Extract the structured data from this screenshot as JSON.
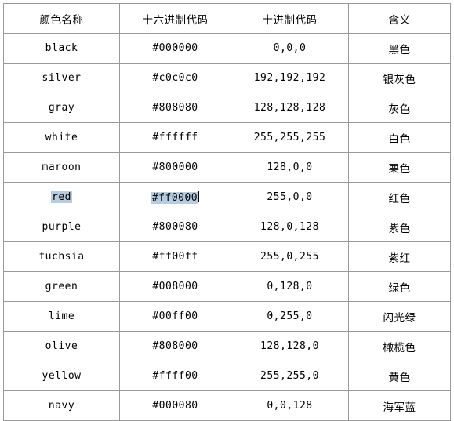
{
  "table": {
    "headers": [
      "颜色名称",
      "十六进制代码",
      "十进制代码",
      "含义"
    ],
    "rows": [
      {
        "name": "black",
        "hex": "#000000",
        "dec": "0,0,0",
        "meaning": "黑色"
      },
      {
        "name": "silver",
        "hex": "#c0c0c0",
        "dec": "192,192,192",
        "meaning": "银灰色"
      },
      {
        "name": "gray",
        "hex": "#808080",
        "dec": "128,128,128",
        "meaning": "灰色"
      },
      {
        "name": "white",
        "hex": "#ffffff",
        "dec": "255,255,255",
        "meaning": "白色"
      },
      {
        "name": "maroon",
        "hex": "#800000",
        "dec": "128,0,0",
        "meaning": "栗色"
      },
      {
        "name": "red",
        "hex": "#ff0000",
        "dec": "255,0,0",
        "meaning": "红色"
      },
      {
        "name": "purple",
        "hex": "#800080",
        "dec": "128,0,128",
        "meaning": "紫色"
      },
      {
        "name": "fuchsia",
        "hex": "#ff00ff",
        "dec": "255,0,255",
        "meaning": "紫红"
      },
      {
        "name": "green",
        "hex": "#008000",
        "dec": "0,128,0",
        "meaning": "绿色"
      },
      {
        "name": "lime",
        "hex": "#00ff00",
        "dec": "0,255,0",
        "meaning": "闪光绿"
      },
      {
        "name": "olive",
        "hex": "#808000",
        "dec": "128,128,0",
        "meaning": "橄榄色"
      },
      {
        "name": "yellow",
        "hex": "#ffff00",
        "dec": "255,255,0",
        "meaning": "黄色"
      },
      {
        "name": "navy",
        "hex": "#000080",
        "dec": "0,0,128",
        "meaning": "海军蓝"
      }
    ],
    "selection": {
      "row_index": 5,
      "selected_name": "red",
      "selected_hex": "#ff0000",
      "highlight_color": "#b4cde0"
    }
  }
}
